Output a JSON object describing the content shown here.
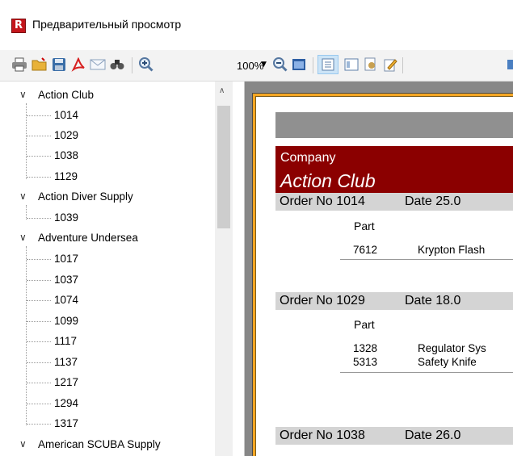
{
  "window": {
    "title": "Предварительный просмотр",
    "app_icon_letter": "R"
  },
  "toolbar": {
    "zoom_value": "100%",
    "icons": [
      "print-icon",
      "open-icon",
      "save-icon",
      "pdf-icon",
      "email-icon",
      "find-icon",
      "zoom-in-icon",
      "zoom-out-icon",
      "full-screen-icon",
      "outline-icon",
      "thumbnails-icon",
      "page-setup-icon",
      "edit-icon",
      "next-icon"
    ]
  },
  "tree": {
    "groups": [
      {
        "label": "Action Club",
        "children": [
          "1014",
          "1029",
          "1038",
          "1129"
        ]
      },
      {
        "label": "Action Diver Supply",
        "children": [
          "1039"
        ]
      },
      {
        "label": "Adventure Undersea",
        "children": [
          "1017",
          "1037",
          "1074",
          "1099",
          "1117",
          "1137",
          "1217",
          "1294",
          "1317"
        ]
      },
      {
        "label": "American SCUBA Supply",
        "children": []
      }
    ]
  },
  "report": {
    "company_label": "Company",
    "company_name": "Action Club",
    "orders": [
      {
        "order_no": "Order No 1014",
        "date": "Date 25.0",
        "part_label": "Part",
        "items": [
          {
            "no": "7612",
            "desc": "Krypton Flash"
          }
        ]
      },
      {
        "order_no": "Order No 1029",
        "date": "Date 18.0",
        "part_label": "Part",
        "items": [
          {
            "no": "1328",
            "desc": "Regulator Sys"
          },
          {
            "no": "5313",
            "desc": "Safety Knife"
          }
        ]
      },
      {
        "order_no": "Order No 1038",
        "date": "Date 26.0",
        "part_label": "",
        "items": []
      }
    ]
  },
  "colors": {
    "company_band": "#8b0000",
    "order_band": "#d4d4d4",
    "page_border": "#f5a623",
    "preview_bg": "#878787"
  }
}
